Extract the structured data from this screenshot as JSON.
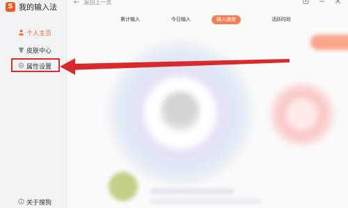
{
  "app": {
    "title": "我的输入法",
    "logo_glyph": "S"
  },
  "sidebar": {
    "items": [
      {
        "label": "个人主页",
        "icon": "person-icon",
        "active": true
      },
      {
        "label": "皮肤中心",
        "icon": "shirt-icon",
        "active": false
      },
      {
        "label": "属性设置",
        "icon": "gear-icon",
        "active": false
      }
    ],
    "footer": {
      "label": "关于搜狗",
      "icon": "info-icon"
    }
  },
  "header": {
    "back_label": "返回上一页",
    "window_controls": [
      "settings-icon",
      "minimize-icon",
      "close-icon"
    ]
  },
  "tabs": [
    {
      "label": "累计输入",
      "active": false
    },
    {
      "label": "今日输入",
      "active": false
    },
    {
      "label": "输入速度",
      "active": true
    },
    {
      "label": "活跃时段",
      "active": false
    }
  ],
  "colors": {
    "accent": "#ec6b2d",
    "active_tab_bg": "#f27f55",
    "annotation_red": "#d82a2a"
  }
}
